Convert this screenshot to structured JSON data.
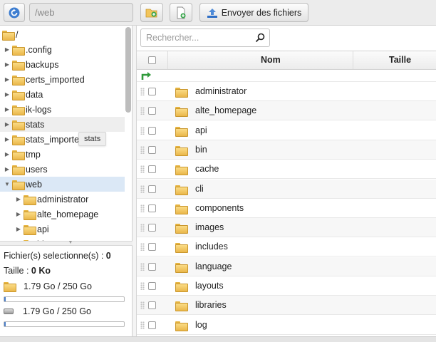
{
  "toolbar": {
    "path_value": "/web",
    "upload_label": "Envoyer des fichiers",
    "icons": [
      "refresh-icon",
      "new-folder-icon",
      "new-file-icon",
      "upload-icon"
    ]
  },
  "tree": {
    "root": "/",
    "items": [
      ".config",
      "backups",
      "certs_imported",
      "data",
      "ik-logs",
      "stats",
      "stats_imported",
      "tmp",
      "users",
      "web"
    ],
    "web_children": [
      "administrator",
      "alte_homepage",
      "api",
      "bin"
    ],
    "tooltip": "stats"
  },
  "info": {
    "selected_label": "Fichier(s) selectionne(s) : ",
    "selected_count": "0",
    "size_label": "Taille : ",
    "size_value": "0 Ko",
    "quota1_text": "1.79 Go / 250 Go",
    "quota2_text": "1.79 Go / 250 Go",
    "quota1_fraction": 0.007,
    "quota2_fraction": 0.007
  },
  "search": {
    "placeholder": "Rechercher..."
  },
  "table": {
    "columns": [
      "Nom",
      "Taille"
    ],
    "rows": [
      "administrator",
      "alte_homepage",
      "api",
      "bin",
      "cache",
      "cli",
      "components",
      "images",
      "includes",
      "language",
      "layouts",
      "libraries",
      "log"
    ]
  },
  "colors": {
    "accent_blue": "#2f6fc6",
    "selection": "#dbe8f6",
    "folder": "#f2c55c"
  }
}
